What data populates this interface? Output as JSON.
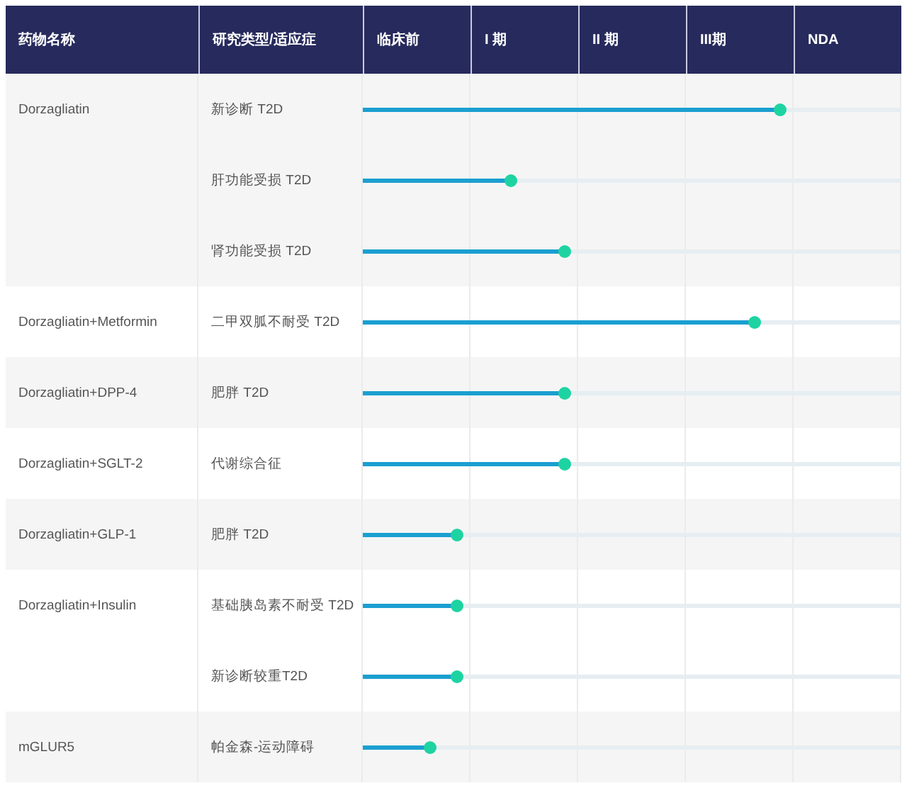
{
  "table": {
    "columns": [
      "药物名称",
      "研究类型/适应症",
      "临床前",
      "I 期",
      "II 期",
      "III期",
      "NDA"
    ],
    "rows": [
      {
        "drug": "Dorzagliatin",
        "studies": [
          {
            "indication": "新诊断 T2D",
            "level": 0.787
          },
          {
            "indication": "肝功能受损 T2D",
            "level": 0.287
          },
          {
            "indication": "肾功能受损 T2D",
            "level": 0.387
          }
        ]
      },
      {
        "drug": "Dorzagliatin+Metformin",
        "studies": [
          {
            "indication": "二甲双胍不耐受 T2D",
            "level": 0.739
          }
        ]
      },
      {
        "drug": "Dorzagliatin+DPP-4",
        "studies": [
          {
            "indication": "肥胖 T2D",
            "level": 0.387
          }
        ]
      },
      {
        "drug": "Dorzagliatin+SGLT-2",
        "studies": [
          {
            "indication": "代谢综合征",
            "level": 0.387
          }
        ]
      },
      {
        "drug": "Dorzagliatin+GLP-1",
        "studies": [
          {
            "indication": "肥胖 T2D",
            "level": 0.187
          }
        ]
      },
      {
        "drug": "Dorzagliatin+Insulin",
        "studies": [
          {
            "indication": "基础胰岛素不耐受 T2D",
            "level": 0.187
          },
          {
            "indication": "新诊断较重T2D",
            "level": 0.187
          }
        ]
      },
      {
        "drug": "mGLUR5",
        "studies": [
          {
            "indication": "帕金森-运动障碍",
            "level": 0.137
          }
        ]
      }
    ]
  }
}
